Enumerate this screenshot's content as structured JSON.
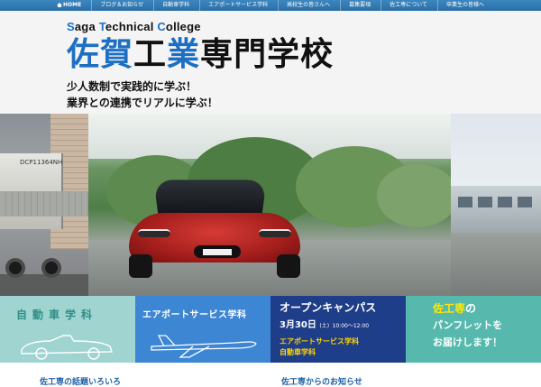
{
  "nav": {
    "items": [
      {
        "label": "HOME",
        "active": true
      },
      {
        "label": "ブログ＆お知らせ"
      },
      {
        "label": "自動車学科"
      },
      {
        "label": "エアポートサービス学科"
      },
      {
        "label": "高校生の皆さんへ"
      },
      {
        "label": "募集要項"
      },
      {
        "label": "佐工専について"
      },
      {
        "label": "卒業生の皆様へ"
      }
    ]
  },
  "header": {
    "english_name": {
      "part1_cap": "S",
      "part1_rest": "aga ",
      "part2_cap": "T",
      "part2_rest": "echnical ",
      "part3_cap": "C",
      "part3_rest": "ollege"
    },
    "title": {
      "part1": "佐賀",
      "part2": "工",
      "part3": "業",
      "part4": "専",
      "part5": "門学校"
    },
    "catch_line_1": "少人数制で実践的に学ぶ！",
    "catch_line_2": "業界との連携でリアルに学ぶ！"
  },
  "hero": {
    "truck_text": "DCP11364NH"
  },
  "banners": {
    "automotive": {
      "title": "自動車学科"
    },
    "airport": {
      "title": "エアポートサービス学科"
    },
    "open_campus": {
      "title": "オープンキャンパス",
      "date_main": "3月30日",
      "date_day": "(土)",
      "time": "10:00～12:00",
      "dept_1": "エアポートサービス学科",
      "dept_2": "自動車学科"
    },
    "pamphlet": {
      "line_1_a": "佐工専",
      "line_1_b": "の",
      "line_2": "パンフレットを",
      "line_3": "お届けします！"
    }
  },
  "sections": {
    "topics_heading": "佐工専の話題いろいろ",
    "news_heading": "佐工専からのお知らせ"
  },
  "colors": {
    "nav_blue": "#2a6ea6",
    "accent_blue": "#1d6fc3",
    "banner_teal_light": "#9fd4d1",
    "banner_blue": "#3d86d3",
    "banner_navy": "#1f3e89",
    "banner_teal": "#57b9ad",
    "highlight_yellow": "#ffd400"
  }
}
